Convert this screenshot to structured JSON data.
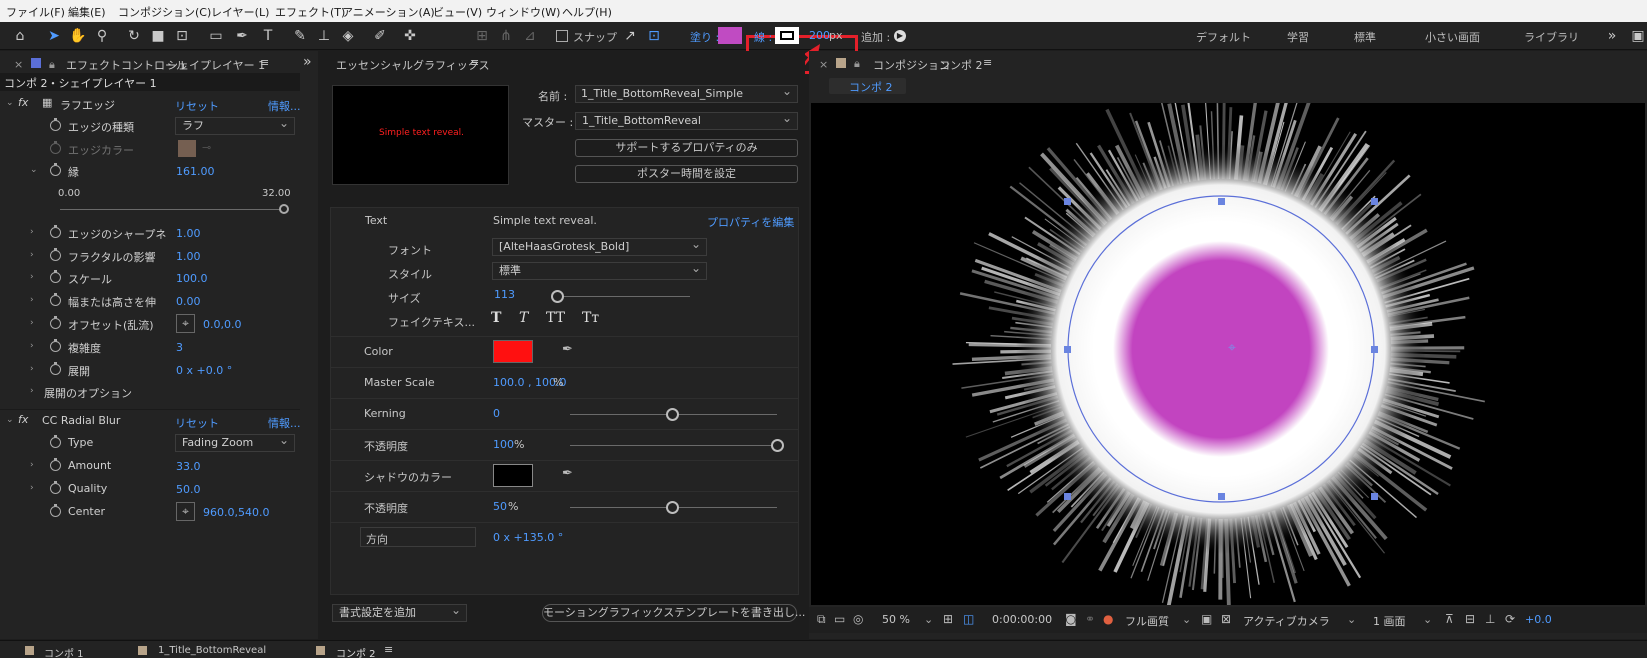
{
  "menu": [
    "ファイル(F)",
    "編集(E)",
    "コンポジション(C)",
    "レイヤー(L)",
    "エフェクト(T)",
    "アニメーション(A)",
    "ビュー(V)",
    "ウィンドウ(W)",
    "ヘルプ(H)"
  ],
  "toolbar": {
    "snap_label": "スナップ",
    "fill_label": "塗り :",
    "stroke_label": "線 :",
    "stroke_width": "200",
    "stroke_unit": "px",
    "add_label": "追加 :",
    "fill_color": "#c04bc2",
    "highlight_color": "#e4202a"
  },
  "workspaces": [
    "デフォルト",
    "学習",
    "標準",
    "小さい画面",
    "ライブラリ"
  ],
  "effect_controls": {
    "tab_label": "エフェクトコントロール",
    "tab_layer": "シェイプレイヤー 1",
    "breadcrumb": "コンポ 2・シェイプレイヤー 1",
    "fx1": {
      "name": "ラフエッジ",
      "reset": "リセット",
      "info": "情報..."
    },
    "rows1": [
      {
        "label": "エッジの種類",
        "value": "ラフ"
      },
      {
        "label": "エッジカラー",
        "value": ""
      },
      {
        "label": "縁",
        "value": "161.00"
      },
      {
        "label": "エッジのシャープネ",
        "value": "1.00"
      },
      {
        "label": "フラクタルの影響",
        "value": "1.00"
      },
      {
        "label": "スケール",
        "value": "100.0"
      },
      {
        "label": "幅または高さを伸",
        "value": "0.00"
      },
      {
        "label": "オフセット(乱流)",
        "value": "0.0,0.0"
      },
      {
        "label": "複雑度",
        "value": "3"
      },
      {
        "label": "展開",
        "value": "0 x +0.0 °"
      },
      {
        "label": "展開のオプション",
        "value": ""
      }
    ],
    "slider_min": "0.00",
    "slider_max": "32.00",
    "edge_color": "#d9a98a",
    "fx2": {
      "name": "CC Radial Blur",
      "reset": "リセット",
      "info": "情報..."
    },
    "rows2": [
      {
        "label": "Type",
        "value": "Fading Zoom"
      },
      {
        "label": "Amount",
        "value": "33.0"
      },
      {
        "label": "Quality",
        "value": "50.0"
      },
      {
        "label": "Center",
        "value": "960.0,540.0"
      }
    ]
  },
  "essential": {
    "tab_label": "エッセンシャルグラフィックス",
    "preview_text": "Simple text reveal.",
    "name_label": "名前 :",
    "name_value": "1_Title_BottomReveal_Simple",
    "master_label": "マスター :",
    "master_value": "1_Title_BottomReveal",
    "btn_supported": "サポートするプロパティのみ",
    "btn_poster": "ポスター時間を設定",
    "text_label": "Text",
    "text_value": "Simple text reveal.",
    "edit_props": "プロパティを編集",
    "font_label": "フォント",
    "font_value": "[AlteHaasGrotesk_Bold]",
    "style_label": "スタイル",
    "style_value": "標準",
    "size_label": "サイズ",
    "size_value": "113",
    "faux_label": "フェイクテキス...",
    "faux_icons": [
      "T",
      "T",
      "TT",
      "Tт"
    ],
    "color_label": "Color",
    "color_value": "#ff1010",
    "master_scale_label": "Master Scale",
    "master_scale_value": "100.0 , 100.0",
    "master_scale_unit": "%",
    "kerning_label": "Kerning",
    "kerning_value": "0",
    "opacity_label": "不透明度",
    "opacity_value": "100",
    "opacity_unit": "%",
    "shadow_color_label": "シャドウのカラー",
    "shadow_color": "#000000",
    "shadow_opacity_label": "不透明度",
    "shadow_opacity_value": "50",
    "shadow_opacity_unit": "%",
    "direction_label": "方向",
    "direction_value": "0 x +135.0 °",
    "add_format": "書式設定を追加",
    "export_template": "モーショングラフィックステンプレートを書き出し..."
  },
  "composition": {
    "tab_label": "コンポジション",
    "tab_comp": "コンポ 2",
    "comp_chip": "コンポ 2",
    "zoom": "50 %",
    "timecode": "0:00:00:00",
    "quality": "フル画質",
    "camera": "アクティブカメラ",
    "views": "1 画面",
    "exposure": "+0.0",
    "circle_color": "#c244c0"
  },
  "bottom_tabs": [
    "コンポ 1",
    "1_Title_BottomReveal",
    "コンポ 2"
  ]
}
